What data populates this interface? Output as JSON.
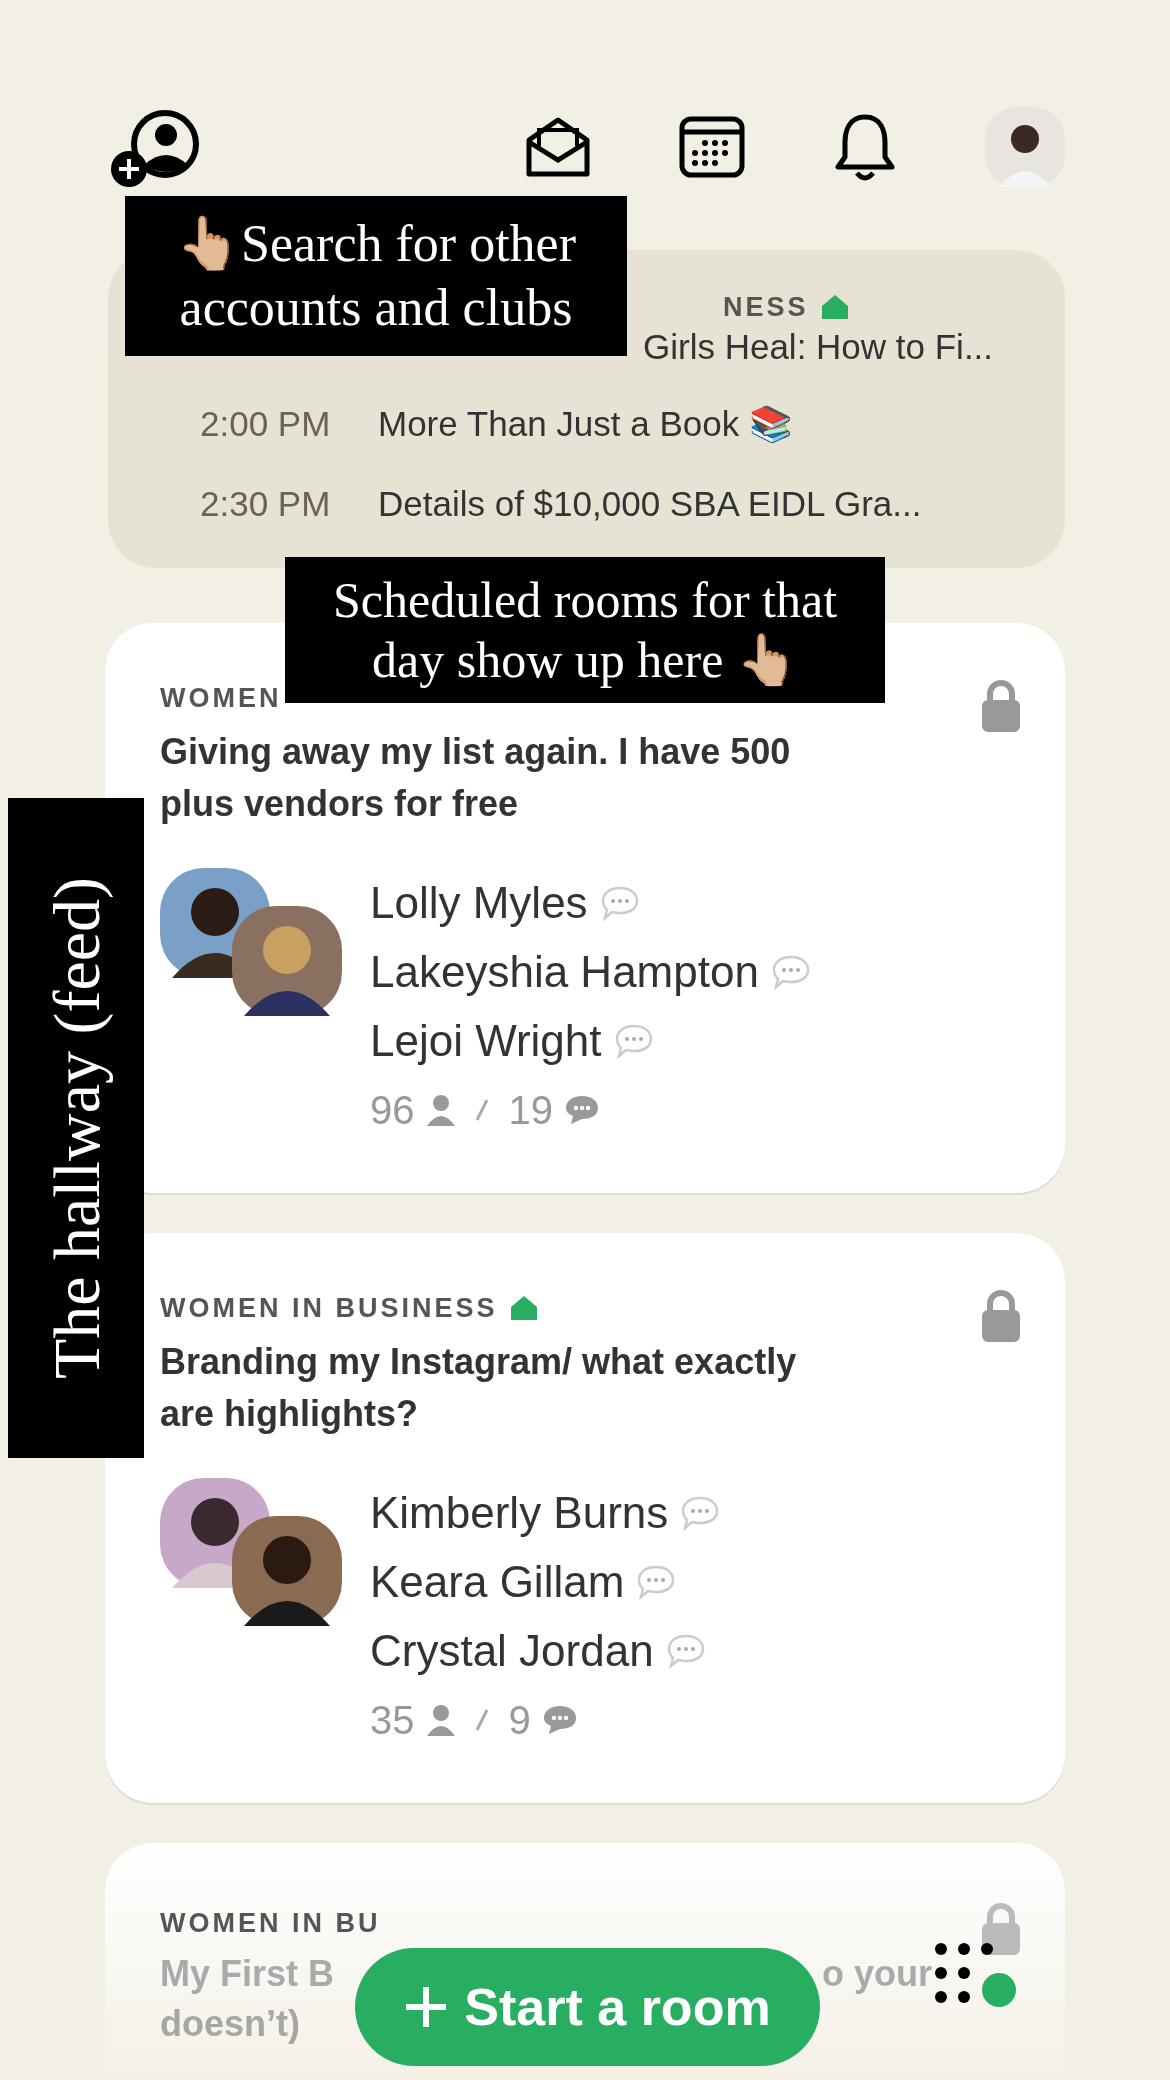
{
  "scheduled": {
    "first": {
      "club": "NESS",
      "title": "Girls Heal: How to Fi..."
    },
    "rows": [
      {
        "time": "2:00 PM",
        "title": "More Than Just a Book 📚"
      },
      {
        "time": "2:30 PM",
        "title": "Details of $10,000 SBA EIDL Gra..."
      }
    ]
  },
  "rooms": [
    {
      "club": "WOMEN",
      "home": false,
      "locked": true,
      "title": "Giving away my list again. I have 500 plus vendors for free",
      "speakers": [
        {
          "name": "Lolly Myles"
        },
        {
          "name": "Lakeyshia Hampton"
        },
        {
          "name": "Lejoi Wright"
        }
      ],
      "listeners": "96",
      "comments": "19"
    },
    {
      "club": "WOMEN IN BUSINESS",
      "home": true,
      "locked": true,
      "title": "Branding my Instagram/ what exactly are highlights?",
      "speakers": [
        {
          "name": "Kimberly Burns"
        },
        {
          "name": "Keara Gillam"
        },
        {
          "name": "Crystal Jordan"
        }
      ],
      "listeners": "35",
      "comments": "9"
    }
  ],
  "faded_room": {
    "club": "WOMEN IN BU",
    "locked": true,
    "fragments": [
      "My First B",
      "o your",
      "doesn’t)"
    ]
  },
  "start_button": "Start a room",
  "annotations": [
    {
      "kind": "search",
      "text": "👆🏼Search for other accounts and clubs"
    },
    {
      "kind": "scheduled",
      "text": "Scheduled rooms for that day show up here 👆🏼"
    },
    {
      "kind": "vertical",
      "text": "The hallway (feed)"
    }
  ]
}
